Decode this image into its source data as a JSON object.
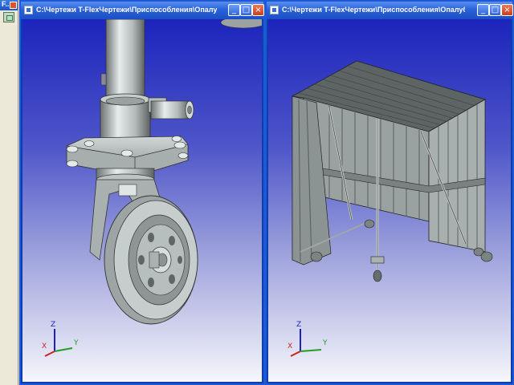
{
  "mini_panel": {
    "title": "F.."
  },
  "windows": [
    {
      "title": "C:\\Чертежи T-FlexЧертежи\\Приспособления\\Опалубка\\К...",
      "buttons": {
        "minimize": "_",
        "maximize": "□",
        "close": "×"
      }
    },
    {
      "title": "C:\\Чертежи T-FlexЧертежи\\Приспособления\\Опалубка\\К...",
      "buttons": {
        "minimize": "_",
        "maximize": "□",
        "close": "×"
      }
    }
  ],
  "triad": {
    "x": "X",
    "y": "Y",
    "z": "Z"
  },
  "colors": {
    "titlebar": "#2a62d8",
    "viewport_top": "#1c24bd",
    "viewport_bottom": "#f6f6fb",
    "axis_x": "#d02020",
    "axis_y": "#20a020",
    "axis_z": "#2020c0"
  }
}
